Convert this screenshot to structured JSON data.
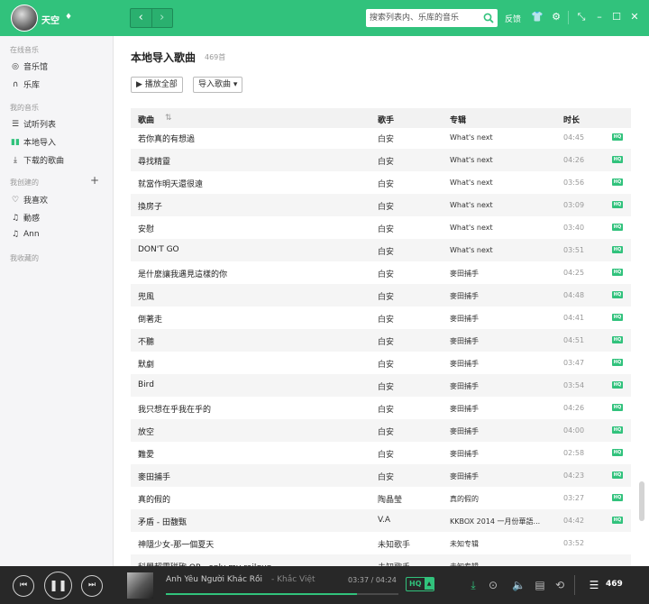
{
  "user": {
    "name": "天空"
  },
  "header": {
    "search_placeholder": "搜索列表内、乐库的音乐",
    "feedback_label": "反馈"
  },
  "sidebar": {
    "online_title": "在线音乐",
    "online_items": [
      {
        "label": "音乐馆"
      },
      {
        "label": "乐库"
      }
    ],
    "mine_title": "我的音乐",
    "mine_items": [
      {
        "label": "试听列表"
      },
      {
        "label": "本地导入"
      },
      {
        "label": "下载的歌曲"
      }
    ],
    "created_title": "我创建的",
    "created_items": [
      {
        "label": "我喜欢"
      },
      {
        "label": "動感"
      },
      {
        "label": "Ann"
      }
    ],
    "collected_title": "我收藏的"
  },
  "main": {
    "title": "本地导入歌曲",
    "count": "469首",
    "play_all_label": "播放全部",
    "import_label": "导入歌曲",
    "columns": {
      "name": "歌曲",
      "artist": "歌手",
      "album": "专辑",
      "duration": "时长"
    },
    "hq_label": "HQ",
    "rows": [
      {
        "name": "若你真的有想過",
        "artist": "白安",
        "album": "What's next",
        "duration": "04:45",
        "hq": true
      },
      {
        "name": "尋找精靈",
        "artist": "白安",
        "album": "What's next",
        "duration": "04:26",
        "hq": true
      },
      {
        "name": "就當作明天還很遠",
        "artist": "白安",
        "album": "What's next",
        "duration": "03:56",
        "hq": true
      },
      {
        "name": "換房子",
        "artist": "白安",
        "album": "What's next",
        "duration": "03:09",
        "hq": true
      },
      {
        "name": "安慰",
        "artist": "白安",
        "album": "What's next",
        "duration": "03:40",
        "hq": true
      },
      {
        "name": "DON'T GO",
        "artist": "白安",
        "album": "What's next",
        "duration": "03:51",
        "hq": true
      },
      {
        "name": "是什麼讓我遇見這樣的你",
        "artist": "白安",
        "album": "麥田捕手",
        "duration": "04:25",
        "hq": true
      },
      {
        "name": "兜風",
        "artist": "白安",
        "album": "麥田捕手",
        "duration": "04:48",
        "hq": true
      },
      {
        "name": "倒著走",
        "artist": "白安",
        "album": "麥田捕手",
        "duration": "04:41",
        "hq": true
      },
      {
        "name": "不聽",
        "artist": "白安",
        "album": "麥田捕手",
        "duration": "04:51",
        "hq": true
      },
      {
        "name": "默劇",
        "artist": "白安",
        "album": "麥田捕手",
        "duration": "03:47",
        "hq": true
      },
      {
        "name": "Bird",
        "artist": "白安",
        "album": "麥田捕手",
        "duration": "03:54",
        "hq": true
      },
      {
        "name": "我只想在乎我在乎的",
        "artist": "白安",
        "album": "麥田捕手",
        "duration": "04:26",
        "hq": true
      },
      {
        "name": "放空",
        "artist": "白安",
        "album": "麥田捕手",
        "duration": "04:00",
        "hq": true
      },
      {
        "name": "難愛",
        "artist": "白安",
        "album": "麥田捕手",
        "duration": "02:58",
        "hq": true
      },
      {
        "name": "麥田捕手",
        "artist": "白安",
        "album": "麥田捕手",
        "duration": "04:23",
        "hq": true
      },
      {
        "name": "真的假的",
        "artist": "陶晶瑩",
        "album": "真的假的",
        "duration": "03:27",
        "hq": true
      },
      {
        "name": "矛盾 - 田馥甄",
        "artist": "V.A",
        "album": "KKBOX 2014 一月份華語...",
        "duration": "04:42",
        "hq": true
      },
      {
        "name": "神隱少女-那一個夏天",
        "artist": "未知歌手",
        "album": "未知专辑",
        "duration": "03:52",
        "hq": false
      },
      {
        "name": "科學超電磁砲 OP - only my railgun",
        "artist": "未知歌手",
        "album": "未知专辑",
        "duration": "",
        "hq": false
      }
    ]
  },
  "player": {
    "song": "Anh Yêu Người Khác Rồi",
    "separator": "-",
    "singer": "Khắc Việt",
    "current_time": "03:37",
    "total_time": "04:24",
    "progress": 0.82,
    "quality": "HQ",
    "playlist_count": "469"
  },
  "colors": {
    "accent": "#31c27c",
    "player_bg": "#282828"
  }
}
